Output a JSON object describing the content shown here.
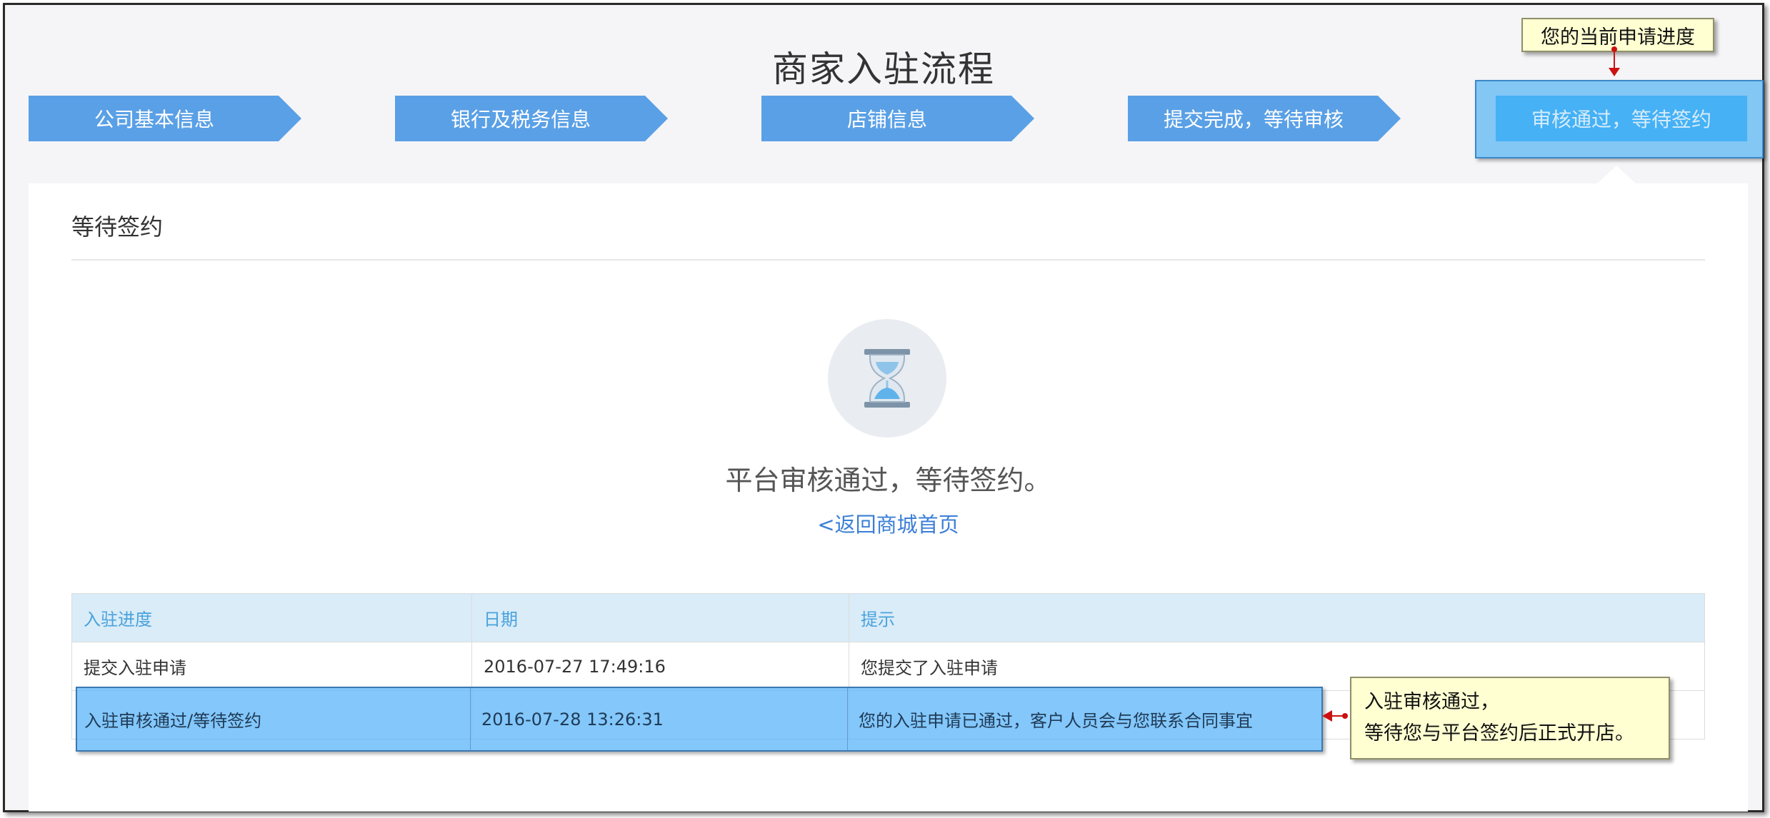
{
  "page": {
    "title": "商家入驻流程"
  },
  "steps": [
    {
      "label": "公司基本信息"
    },
    {
      "label": "银行及税务信息"
    },
    {
      "label": "店铺信息"
    },
    {
      "label": "提交完成，等待审核"
    },
    {
      "label": "审核通过，等待签约"
    }
  ],
  "callouts": {
    "current_progress": "您的当前申请进度",
    "approval_line1": "入驻审核通过，",
    "approval_line2": "等待您与平台签约后正式开店。"
  },
  "panel": {
    "section_title": "等待签约",
    "status_text": "平台审核通过，等待签约。",
    "back_link": "<返回商城首页"
  },
  "table": {
    "headers": [
      "入驻进度",
      "日期",
      "提示"
    ],
    "rows": [
      [
        "提交入驻申请",
        "2016-07-27 17:49:16",
        "您提交了入驻申请"
      ],
      [
        "入驻审核通过/等待签约",
        "2016-07-28 13:26:31",
        "您的入驻申请已通过，客户人员会与您联系合同事宜"
      ]
    ]
  },
  "icons": {
    "status": "hourglass-icon"
  },
  "colors": {
    "step_bg": "#5aa0e6",
    "current_step_bg": "#46b1f5",
    "link": "#3b7fd6",
    "header_text": "#4aa2dc",
    "callout_bg": "#ffffd2",
    "arrow": "#cc1111"
  }
}
